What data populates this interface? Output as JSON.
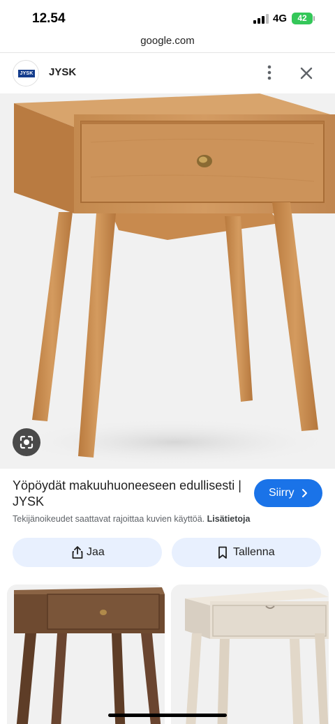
{
  "status_bar": {
    "time": "12.54",
    "network": "4G",
    "battery": "42"
  },
  "browser": {
    "url": "google.com"
  },
  "site": {
    "name": "JYSK",
    "logo_text": "JYSK"
  },
  "result": {
    "title": "Yöpöydät makuuhuoneeseen edullisesti | JYSK",
    "visit_label": "Siirry",
    "copyright_text": "Tekijänoikeudet saattavat rajoittaa kuvien käyttöä.",
    "learn_more": "Lisätietoja"
  },
  "actions": {
    "share_label": "Jaa",
    "save_label": "Tallenna"
  },
  "icons": {
    "more": "more-vert-icon",
    "close": "close-icon",
    "lens": "google-lens-icon",
    "share": "share-icon",
    "save": "bookmark-icon",
    "visit": "chevron-right-icon"
  },
  "colors": {
    "accent_blue": "#1a73e8",
    "tonal_button": "#e8f0fe",
    "oak": "#c98f55",
    "walnut": "#6e4a30",
    "white_wash": "#e8e0d4"
  }
}
